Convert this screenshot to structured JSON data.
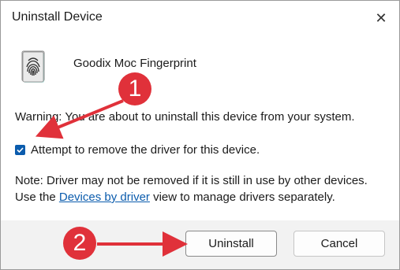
{
  "dialog": {
    "title": "Uninstall Device",
    "close_label": "✕"
  },
  "device": {
    "name": "Goodix Moc Fingerprint",
    "icon": "fingerprint-icon"
  },
  "warning": {
    "text": "Warning: You are about to uninstall this device from your system."
  },
  "checkbox": {
    "label": "Attempt to remove the driver for this device.",
    "checked": true
  },
  "note": {
    "before_link": "Note: Driver may not be removed if it is still in use by other devices. Use the ",
    "link_text": "Devices by driver",
    "after_link": " view to manage drivers separately."
  },
  "buttons": {
    "uninstall": "Uninstall",
    "cancel": "Cancel"
  },
  "annotations": {
    "badge1": "1",
    "badge2": "2",
    "color": "#e0313a"
  }
}
